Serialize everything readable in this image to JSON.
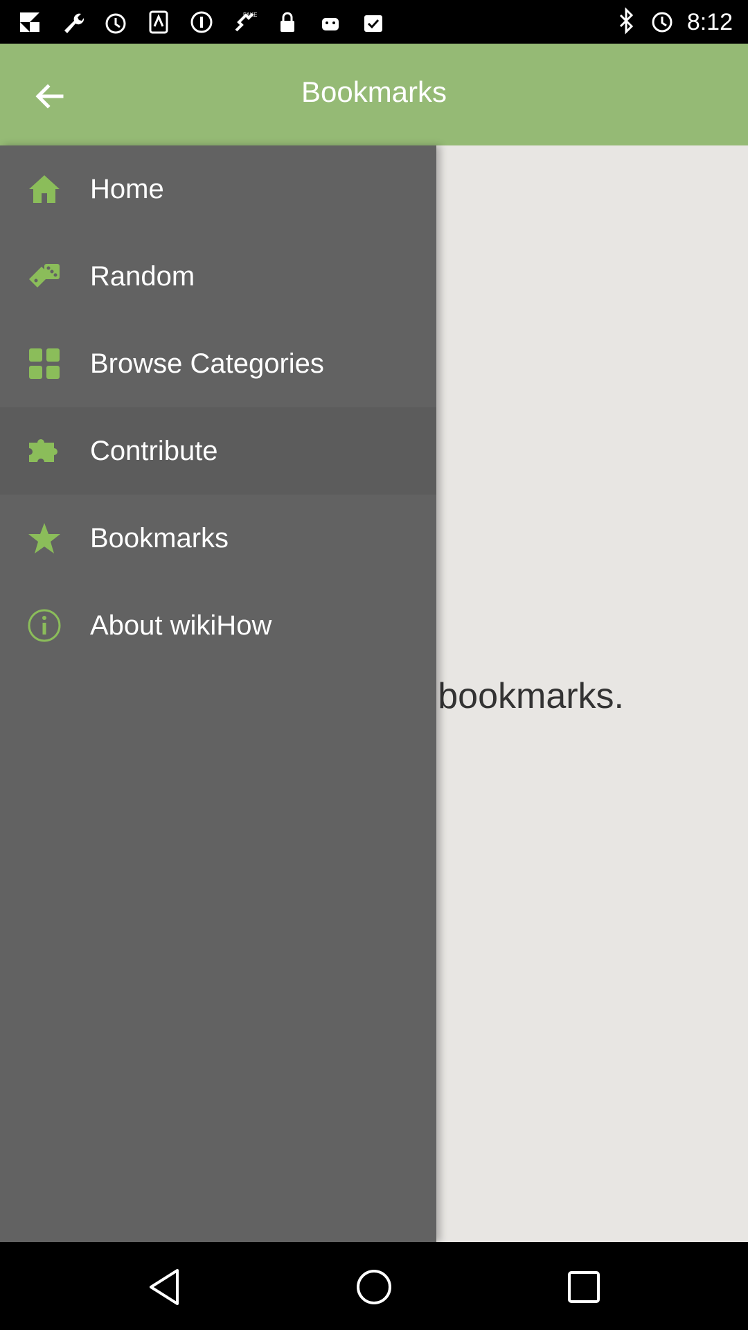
{
  "status_bar": {
    "time": "8:12",
    "left_icons": [
      "pinwheel-icon",
      "wrench-icon",
      "alarm-icon",
      "sim-icon",
      "settings-icon",
      "fake-gps-icon",
      "lock-icon",
      "android-icon",
      "checkbox-icon"
    ],
    "right_icons": [
      "bluetooth-icon",
      "alarm-icon"
    ]
  },
  "app_bar": {
    "title": "Bookmarks",
    "back_icon": "arrow-left-icon",
    "color": "#95ba75"
  },
  "content": {
    "empty_message": "You don't have any bookmarks."
  },
  "drawer": {
    "items": [
      {
        "label": "Home",
        "icon": "home-icon"
      },
      {
        "label": "Random",
        "icon": "dice-icon"
      },
      {
        "label": "Browse Categories",
        "icon": "grid-icon"
      },
      {
        "label": "Contribute",
        "icon": "puzzle-icon"
      },
      {
        "label": "Bookmarks",
        "icon": "star-icon"
      },
      {
        "label": "About wikiHow",
        "icon": "info-icon"
      }
    ],
    "icon_color": "#8bbd5a",
    "background": "#626262"
  },
  "nav_bar": {
    "buttons": [
      "back-triangle-icon",
      "home-circle-icon",
      "recents-square-icon"
    ]
  }
}
